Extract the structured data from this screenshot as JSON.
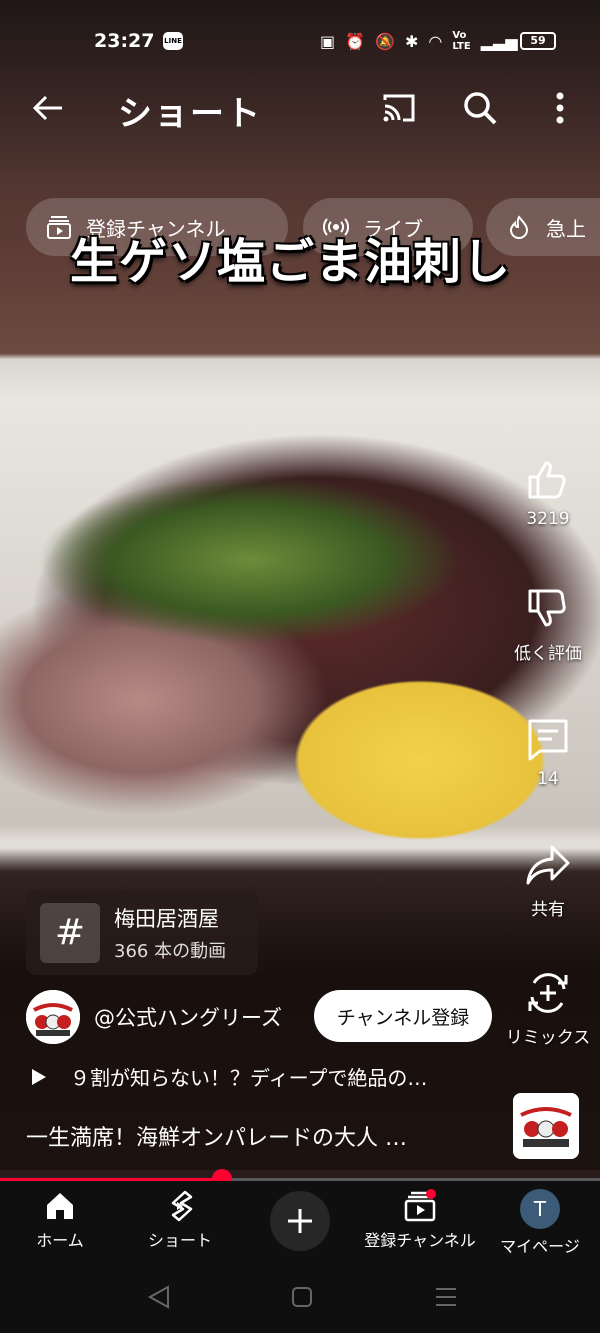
{
  "status_bar": {
    "time": "23:27",
    "line_badge": "LINE",
    "battery": "59"
  },
  "app_bar": {
    "title": "ショート"
  },
  "chips": [
    {
      "label": "登録チャンネル",
      "icon": "subscriptions-icon"
    },
    {
      "label": "ライブ",
      "icon": "live-icon"
    },
    {
      "label": "急上",
      "icon": "trending-icon"
    }
  ],
  "video": {
    "caption": "生ゲソ塩ごま油刺し"
  },
  "actions": {
    "like_count": "3219",
    "dislike_label": "低く評価",
    "comment_count": "14",
    "share_label": "共有",
    "remix_label": "リミックス"
  },
  "place": {
    "name": "梅田居酒屋",
    "count": "366 本の動画"
  },
  "channel": {
    "name": "@公式ハングリーズ",
    "subscribe_label": "チャンネル登録"
  },
  "description": "９割が知らない！？ディープで絶品の…",
  "title": "一生満席！海鮮オンパレードの大人 …",
  "progress": 0.37,
  "bottom_nav": [
    {
      "label": "ホーム",
      "icon": "home-icon"
    },
    {
      "label": "ショート",
      "icon": "shorts-icon"
    },
    {
      "label": "",
      "icon": "create-icon"
    },
    {
      "label": "登録チャンネル",
      "icon": "subscriptions-icon"
    },
    {
      "label": "マイページ",
      "icon": "avatar-icon",
      "avatar_letter": "T"
    }
  ],
  "colors": {
    "accent": "#ff0033",
    "nav_bg": "#0f0f0f",
    "avatar_bg": "#3b5b78"
  }
}
